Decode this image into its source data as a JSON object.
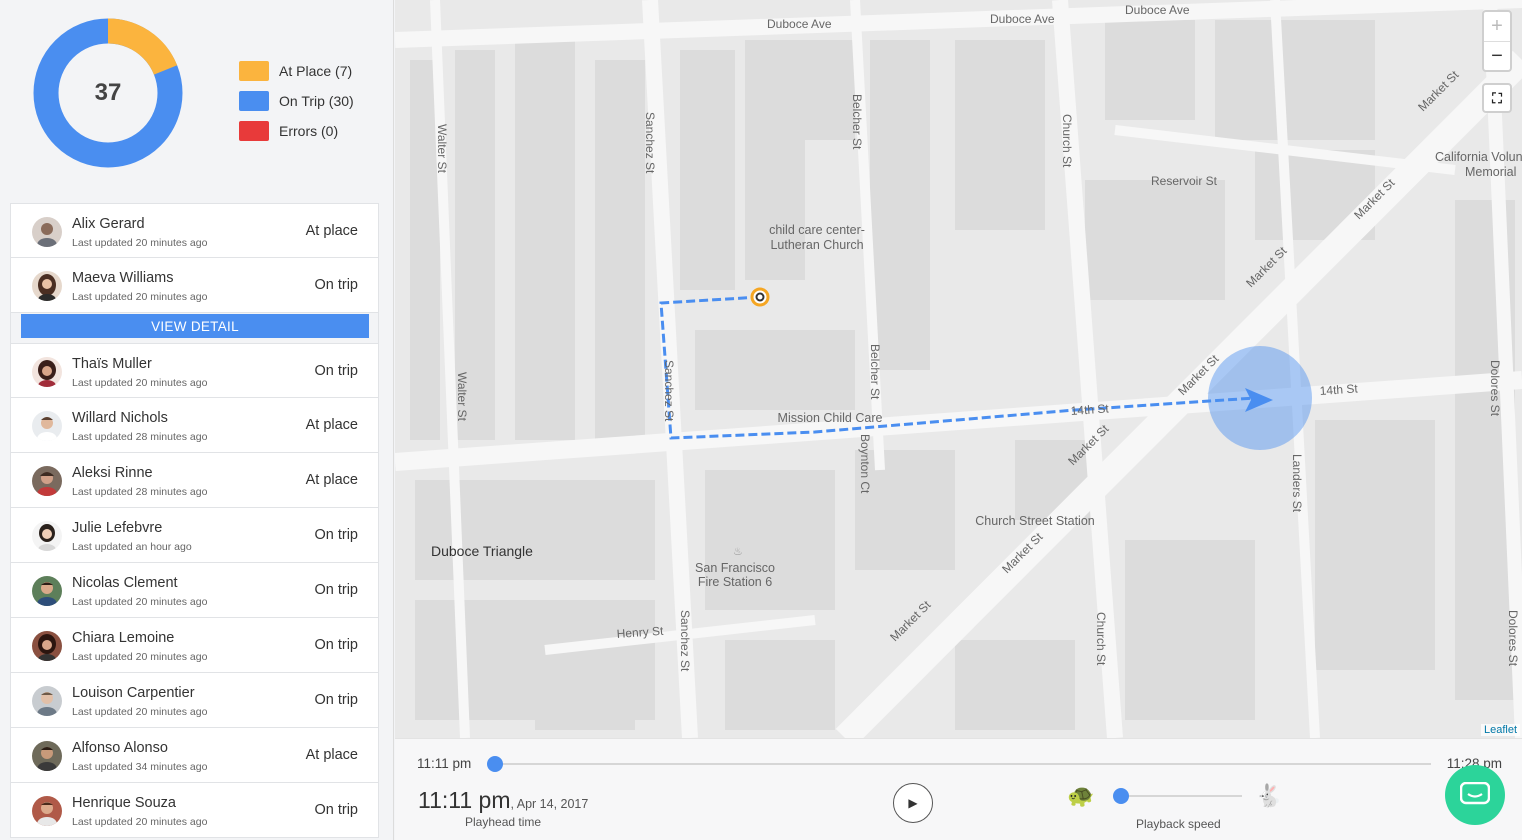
{
  "summary": {
    "total": "37",
    "legend": [
      {
        "label": "At Place (7)",
        "color": "#fbb43e",
        "value": 7
      },
      {
        "label": "On Trip (30)",
        "color": "#4a8ef0",
        "value": 30
      },
      {
        "label": "Errors (0)",
        "color": "#e83a3a",
        "value": 0
      }
    ]
  },
  "users": [
    {
      "name": "Alix Gerard",
      "updated": "Last updated 20 minutes ago",
      "status": "At place"
    },
    {
      "name": "Maeva Williams",
      "updated": "Last updated 20 minutes ago",
      "status": "On trip"
    },
    {
      "name": "Thaïs Muller",
      "updated": "Last updated 20 minutes ago",
      "status": "On trip"
    },
    {
      "name": "Willard Nichols",
      "updated": "Last updated 28 minutes ago",
      "status": "At place"
    },
    {
      "name": "Aleksi Rinne",
      "updated": "Last updated 28 minutes ago",
      "status": "At place"
    },
    {
      "name": "Julie Lefebvre",
      "updated": "Last updated an hour ago",
      "status": "On trip"
    },
    {
      "name": "Nicolas Clement",
      "updated": "Last updated 20 minutes ago",
      "status": "On trip"
    },
    {
      "name": "Chiara Lemoine",
      "updated": "Last updated 20 minutes ago",
      "status": "On trip"
    },
    {
      "name": "Louison Carpentier",
      "updated": "Last updated 20 minutes ago",
      "status": "On trip"
    },
    {
      "name": "Alfonso Alonso",
      "updated": "Last updated 34 minutes ago",
      "status": "At place"
    },
    {
      "name": "Henrique Souza",
      "updated": "Last updated 20 minutes ago",
      "status": "On trip"
    }
  ],
  "view_detail_label": "VIEW DETAIL",
  "map": {
    "streets": {
      "duboce1": "Duboce Ave",
      "duboce2": "Duboce Ave",
      "duboce3": "Duboce Ave",
      "walter1": "Walter St",
      "walter2": "Walter St",
      "sanchez1": "Sanchez St",
      "sanchez2": "Sanchez St",
      "sanchez3": "Sanchez St",
      "belcher1": "Belcher St",
      "belcher2": "Belcher St",
      "church1": "Church St",
      "church2": "Church St",
      "reservoir": "Reservoir St",
      "market1": "Market St",
      "market2": "Market St",
      "market3": "Market St",
      "market4": "Market St",
      "market5": "Market St",
      "market6": "Market St",
      "market7": "Market St",
      "fourteenth1": "14th St",
      "fourteenth2": "14th St",
      "boynton": "Boynton Ct",
      "landers": "Landers St",
      "dolores1": "Dolores St",
      "dolores2": "Dolores St",
      "henry": "Henry St"
    },
    "pois": {
      "childcare1": "child care center-",
      "childcare2": "Lutheran Church",
      "mission": "Mission Child Care",
      "duboce_triangle": "Duboce Triangle",
      "church_station": "Church Street Station",
      "fire1": "San Francisco",
      "fire2": "Fire Station 6",
      "california1": "California Volun",
      "california2": "Memorial"
    },
    "zoom_in": "+",
    "zoom_out": "−",
    "fullscreen": "⛶",
    "attribution": "Leaflet",
    "route_color": "#4a8ef0",
    "origin_color": "#f5a623"
  },
  "playback": {
    "start": "11:11 pm",
    "end": "11:28 pm",
    "time": "11:11 pm",
    "date": ", Apr 14, 2017",
    "time_label": "Playhead time",
    "speed_label": "Playback speed",
    "progress": 0,
    "speed": 0,
    "play_icon": "▶",
    "turtle_icon": "🐢",
    "rabbit_icon": "🐇"
  }
}
